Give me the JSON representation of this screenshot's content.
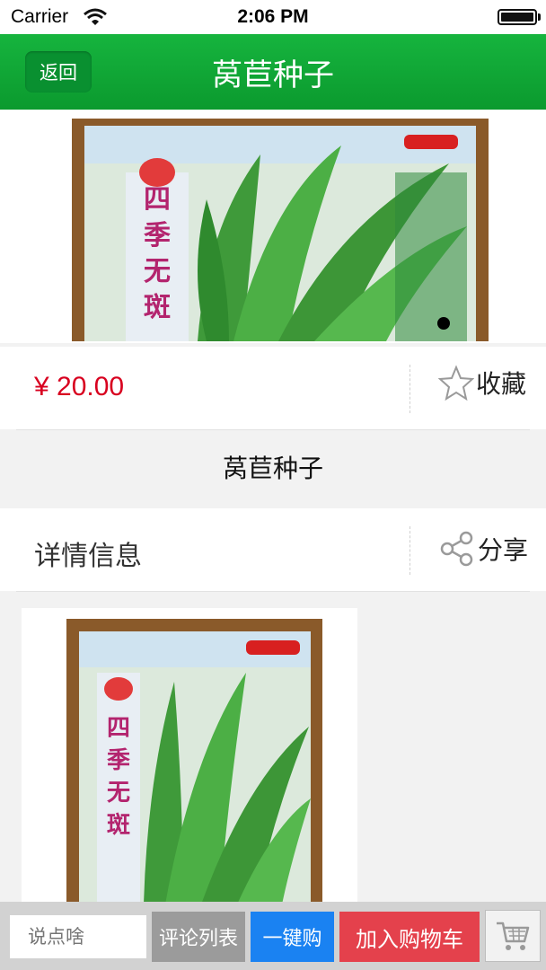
{
  "status_bar": {
    "carrier": "Carrier",
    "time": "2:06 PM"
  },
  "nav": {
    "back_label": "返回",
    "title": "莴苣种子"
  },
  "product": {
    "price": "¥ 20.00",
    "favorite_label": "收藏",
    "name": "莴苣种子",
    "gallery_pages": 1,
    "gallery_current_page": 1
  },
  "details": {
    "label": "详情信息",
    "share_label": "分享"
  },
  "bottom_bar": {
    "comment_placeholder": "说点啥",
    "comments_button": "评论列表",
    "buy_now_button": "一键购",
    "add_to_cart_button": "加入购物车",
    "cart_icon": "shopping-cart-icon"
  },
  "colors": {
    "nav_green": "#0fa636",
    "price_red": "#d8001f",
    "buy_now_blue": "#1a82f2",
    "add_to_cart_red": "#e4414c",
    "comments_gray": "#9b9b9b"
  }
}
